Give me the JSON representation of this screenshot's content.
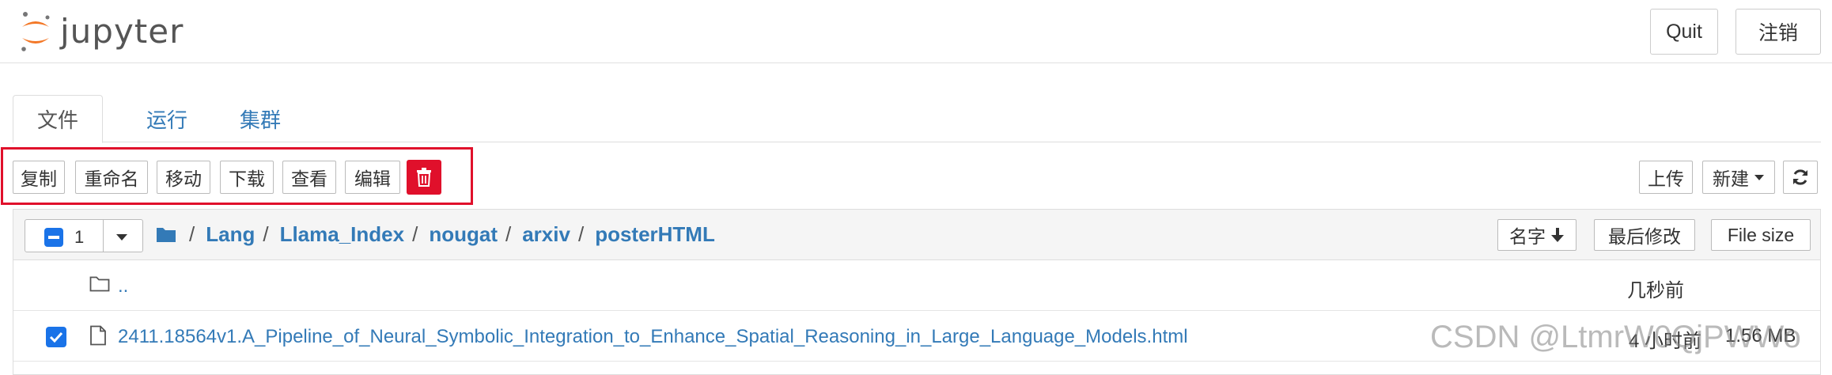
{
  "app": {
    "logo_text": "jupyter"
  },
  "header": {
    "quit_label": "Quit",
    "logout_label": "注销"
  },
  "tabs": [
    {
      "label": "文件",
      "active": true
    },
    {
      "label": "运行",
      "active": false
    },
    {
      "label": "集群",
      "active": false
    }
  ],
  "toolbar": {
    "actions": [
      "复制",
      "重命名",
      "移动",
      "下载",
      "查看",
      "编辑"
    ],
    "delete_icon": "trash-icon",
    "upload_label": "上传",
    "new_label": "新建",
    "refresh_icon": "refresh-icon"
  },
  "list": {
    "selected_count": "1",
    "breadcrumb": [
      "Lang",
      "Llama_Index",
      "nougat",
      "arxiv",
      "posterHTML"
    ],
    "separator": "/",
    "sort_name_label": "名字",
    "sort_modified_label": "最后修改",
    "sort_size_label": "File size",
    "rows": [
      {
        "name": "..",
        "modified": "几秒前",
        "size": "",
        "checked": false,
        "icon": "folder-icon"
      },
      {
        "name": "2411.18564v1.A_Pipeline_of_Neural_Symbolic_Integration_to_Enhance_Spatial_Reasoning_in_Large_Language_Models.html",
        "modified": "4 小时前",
        "size": "1.56 MB",
        "checked": true,
        "icon": "file-icon"
      }
    ]
  },
  "colors": {
    "accent": "#337ab7",
    "danger": "#e0102b",
    "checkbox": "#1a73e8"
  },
  "watermark": "CSDN @LtmrW0QjPWWo"
}
